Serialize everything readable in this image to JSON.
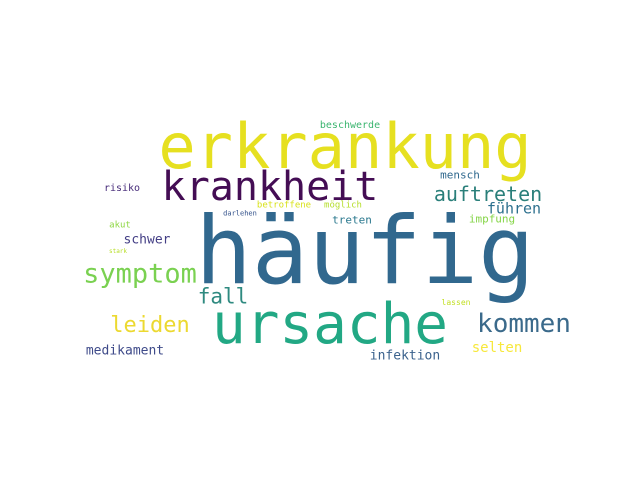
{
  "words": [
    {
      "text": "häufig",
      "color": "#31688e"
    },
    {
      "text": "erkrankung",
      "color": "#e6e020"
    },
    {
      "text": "ursache",
      "color": "#22a884"
    },
    {
      "text": "krankheit",
      "color": "#440d54"
    },
    {
      "text": "symptom",
      "color": "#7ad151"
    },
    {
      "text": "kommen",
      "color": "#3b6a8b"
    },
    {
      "text": "auftreten",
      "color": "#2a7f7a"
    },
    {
      "text": "leiden",
      "color": "#ecd931"
    },
    {
      "text": "fall",
      "color": "#2f8a80"
    },
    {
      "text": "führen",
      "color": "#2c708e"
    },
    {
      "text": "schwer",
      "color": "#433e85"
    },
    {
      "text": "medikament",
      "color": "#3e4a89"
    },
    {
      "text": "infektion",
      "color": "#3b628d"
    },
    {
      "text": "selten",
      "color": "#f7e83d"
    },
    {
      "text": "impfung",
      "color": "#86d549"
    },
    {
      "text": "treten",
      "color": "#2a788e"
    },
    {
      "text": "mensch",
      "color": "#30698e"
    },
    {
      "text": "risiko",
      "color": "#472c7a"
    },
    {
      "text": "beschwerde",
      "color": "#3bb56f"
    },
    {
      "text": "betroffene",
      "color": "#d8e219"
    },
    {
      "text": "möglich",
      "color": "#b5de2b"
    },
    {
      "text": "akut",
      "color": "#8fd744"
    },
    {
      "text": "darlehen",
      "color": "#31508a"
    },
    {
      "text": "lassen",
      "color": "#c2df23"
    },
    {
      "text": "stark",
      "color": "#b8de29"
    }
  ]
}
